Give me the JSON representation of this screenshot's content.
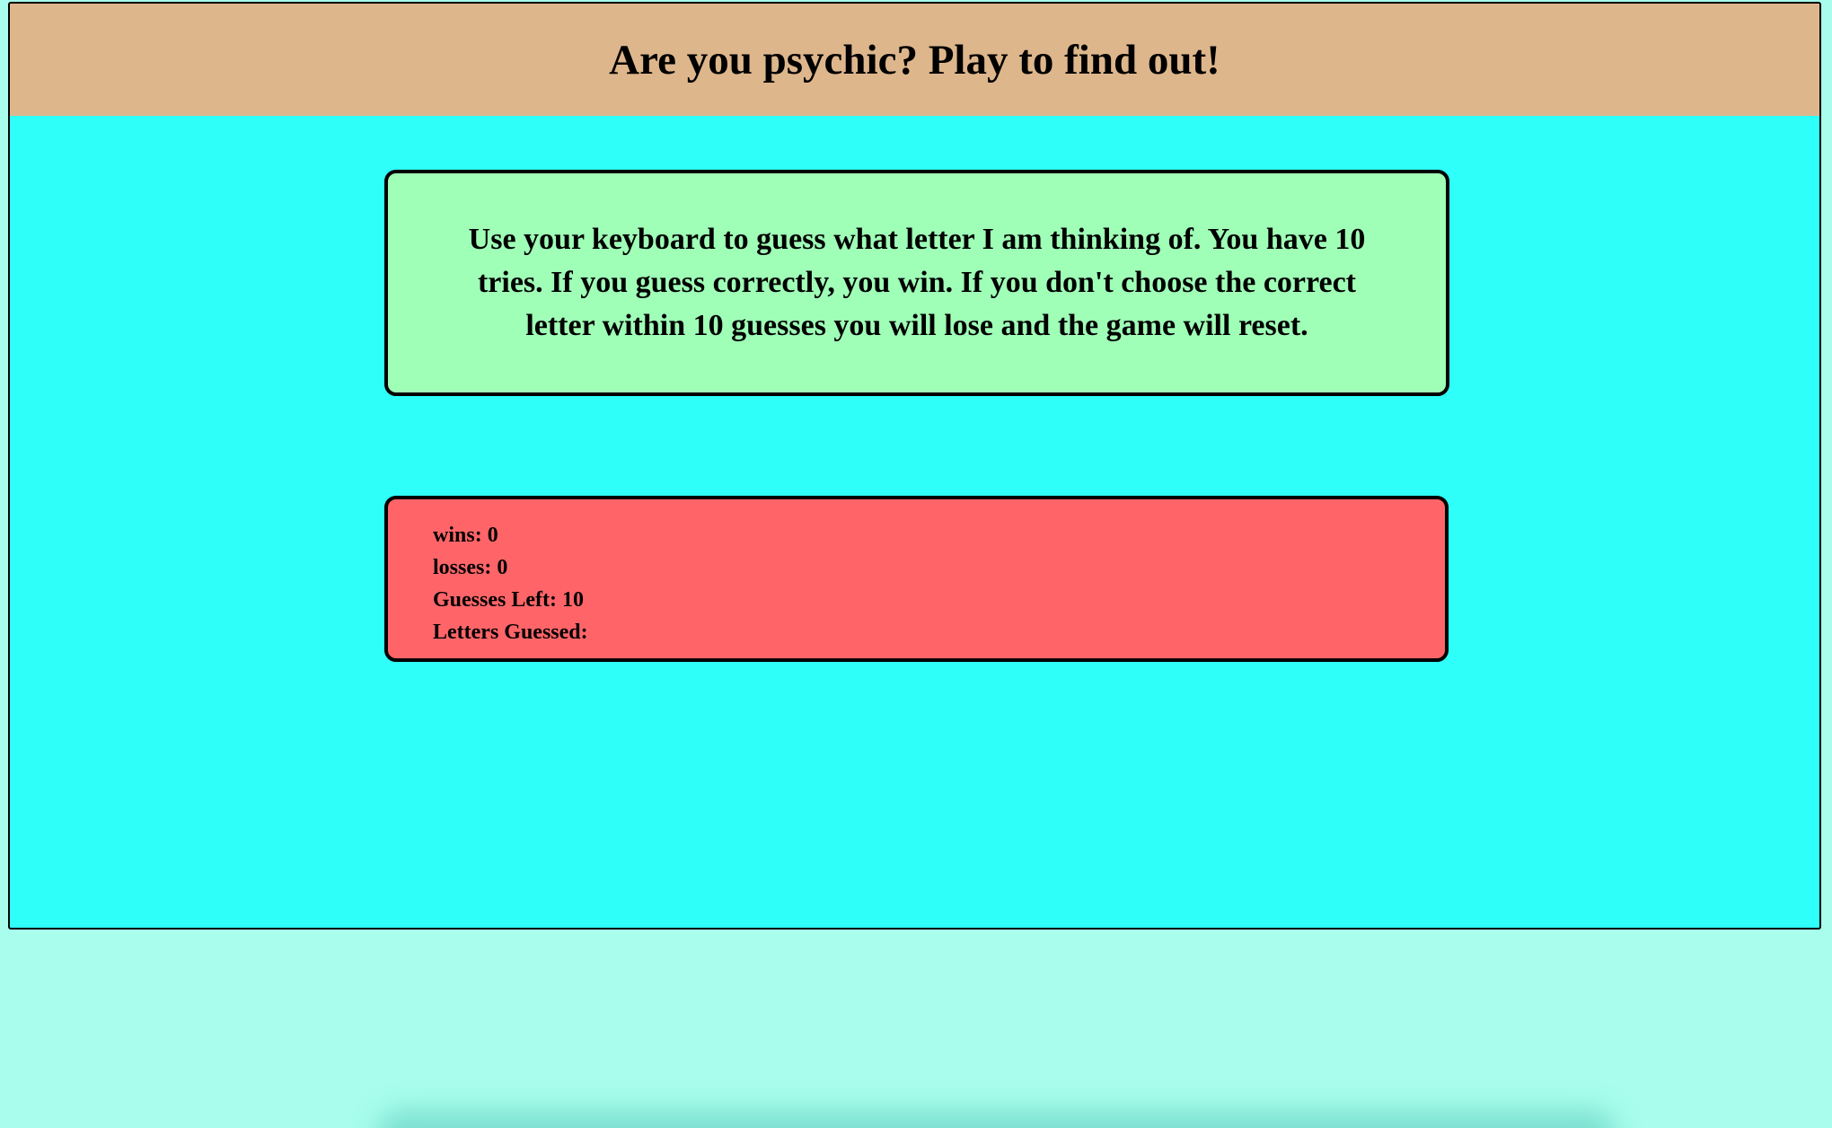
{
  "header": {
    "title": "Are you psychic? Play to find out!"
  },
  "instructions": {
    "text": "Use your keyboard to guess what letter I am thinking of. You have 10 tries. If you guess correctly, you win. If you don't choose the correct letter within 10 guesses you will lose and the game will reset."
  },
  "scoreboard": {
    "wins_label": "wins:",
    "wins_value": "0",
    "losses_label": "losses:",
    "losses_value": "0",
    "guesses_left_label": "Guesses Left:",
    "guesses_left_value": "10",
    "letters_guessed_label": "Letters Guessed:",
    "letters_guessed_value": ""
  },
  "colors": {
    "page_background": "#a8fdec",
    "game_background": "#2ffff9",
    "header_background": "#deb68c",
    "instructions_background": "#9fffb7",
    "scoreboard_background": "#ff6568"
  }
}
